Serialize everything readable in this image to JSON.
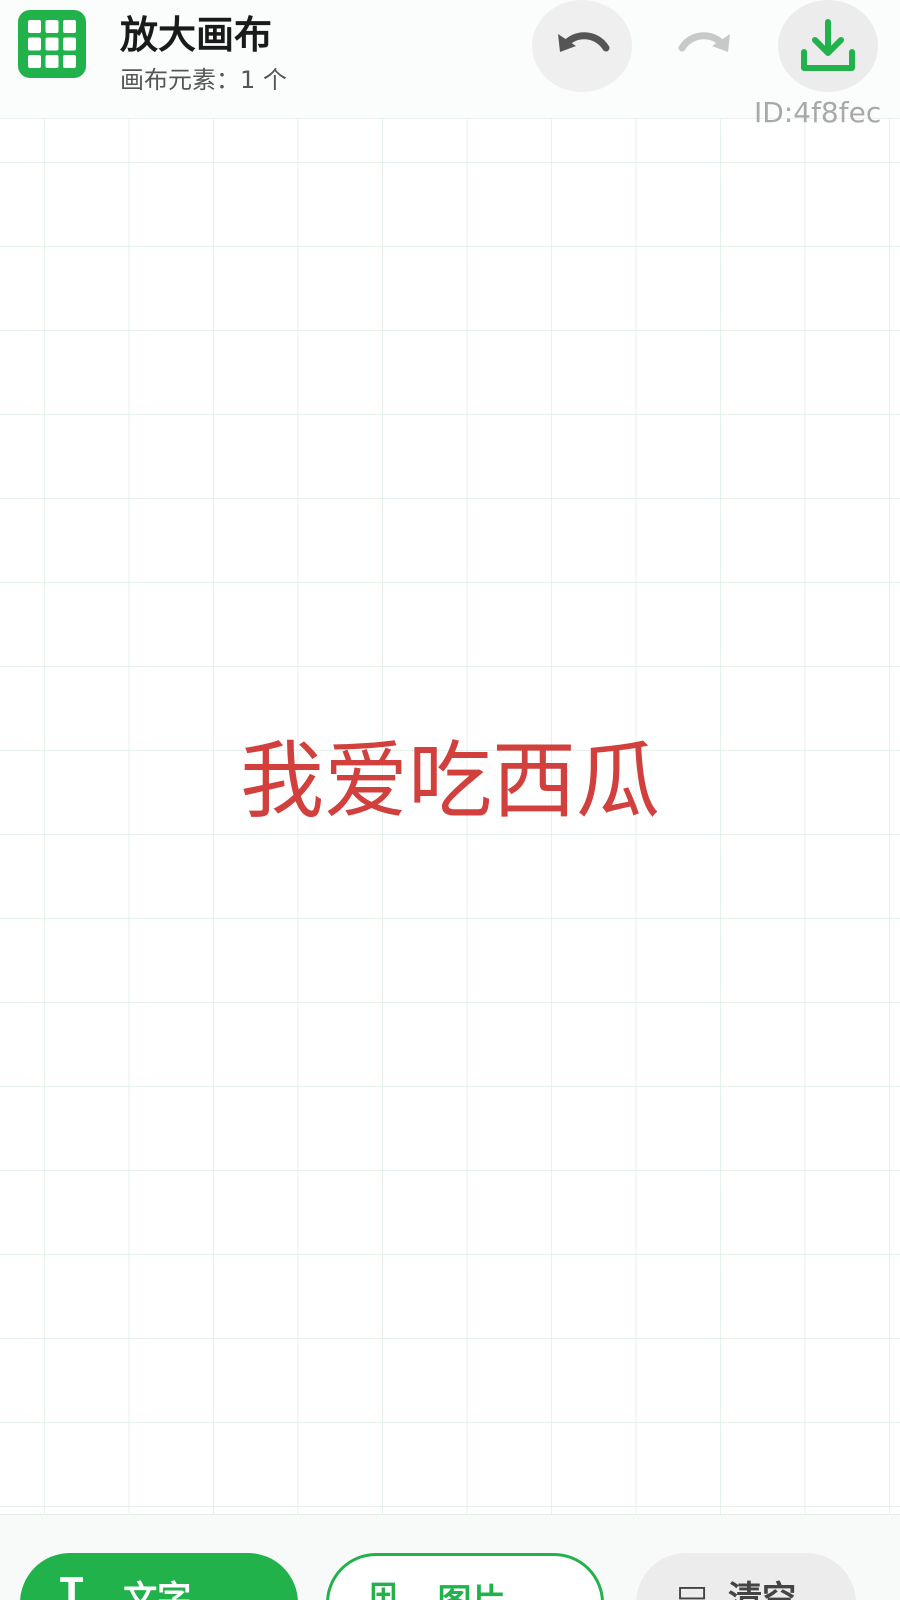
{
  "header": {
    "title": "放大画布",
    "subtitle": "画布元素：1 个",
    "id_label": "ID:4f8fec",
    "icons": {
      "app": "grid-icon",
      "undo": "undo-icon",
      "redo": "redo-icon",
      "download": "download-icon"
    }
  },
  "canvas": {
    "text": "我爱吃西瓜",
    "text_color": "#d1403d",
    "grid_color": "#e6f1ea"
  },
  "toolbar": {
    "text_label": "文字",
    "image_label": "图片",
    "clear_label": "清空"
  },
  "colors": {
    "accent": "#22b24c",
    "undo_bg": "#efefef",
    "redo_disabled": "#c8c8c8"
  }
}
